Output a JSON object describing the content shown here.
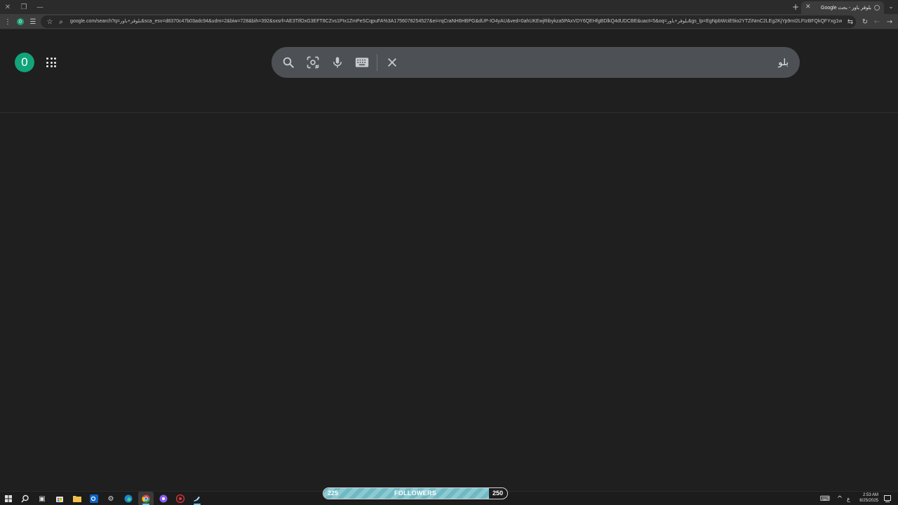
{
  "browser": {
    "tab_title": "بلوقر باور - بحث Google",
    "new_tab_label": "+",
    "url": "google.com/search?q=بلوقر+باور&sca_esv=d8370c47b03adc94&udm=2&biw=728&bih=392&sxsrf=AE3TifOxG3EFT8CZvs1PIx1ZmPeSCqpuFA%3A1756078254527&ei=rqCraNH6HBPG&dUP-IO4yAU&ved=0ahUKEwjRibykza5PAxVDY6QEHfgBDlkQ4dUDCBE&uact=5&oq=بلوقر+باور&gs_lp=EgNpbWciE9io2YTZiNmC2LEg2KjYp9mI2LFIzBFQkQFYxg1wAngAkAE...",
    "profile_initial": "0"
  },
  "google": {
    "avatar_initial": "0",
    "search_query": "بلو",
    "icons": [
      "search-icon",
      "lens-icon",
      "mic-icon",
      "keyboard-icon",
      "clear-icon"
    ]
  },
  "taskbar": {
    "followers_current": "225",
    "followers_label": "FOLLOWERS",
    "followers_goal": "250",
    "followers_progress": 0.9,
    "tray_lang": "ع",
    "time": "2:53 AM",
    "date": "8/25/2025"
  },
  "colors": {
    "page_bg": "#1f1f1f",
    "searchbox_bg": "#4d5156",
    "avatar_bg": "#12a37a",
    "followers_fill": "#6fb9c4"
  }
}
